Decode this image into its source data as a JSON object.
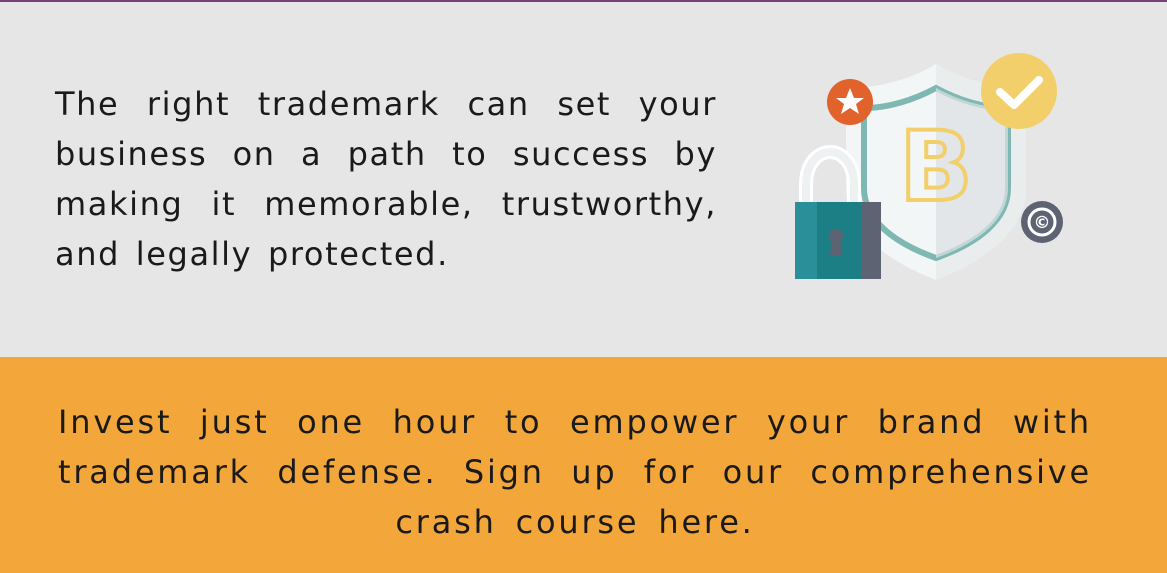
{
  "intro": {
    "text": "The right trademark can set your business on a path to success by making it memorable, trustworthy, and legally protected."
  },
  "illustration": {
    "icons": [
      "padlock-icon",
      "shield-icon",
      "star-badge-icon",
      "checkmark-badge-icon",
      "copyright-icon"
    ],
    "shield_letter": "B",
    "copyright_symbol": "©"
  },
  "cta": {
    "text": "Invest just one hour to empower your brand with trademark defense. Sign up for our comprehensive crash course here."
  },
  "colors": {
    "top_background": "#e6e6e6",
    "bottom_background": "#f3a73b",
    "top_rule": "#7b3f7a",
    "text": "#1a1a1a",
    "shield_outline": "#7fb8b3",
    "shield_letter": "#f2cf6a",
    "star_badge": "#e1622b",
    "check_badge": "#f2cf6a",
    "lock_body": "#2a8f99",
    "copyright_badge": "#5d6373"
  }
}
